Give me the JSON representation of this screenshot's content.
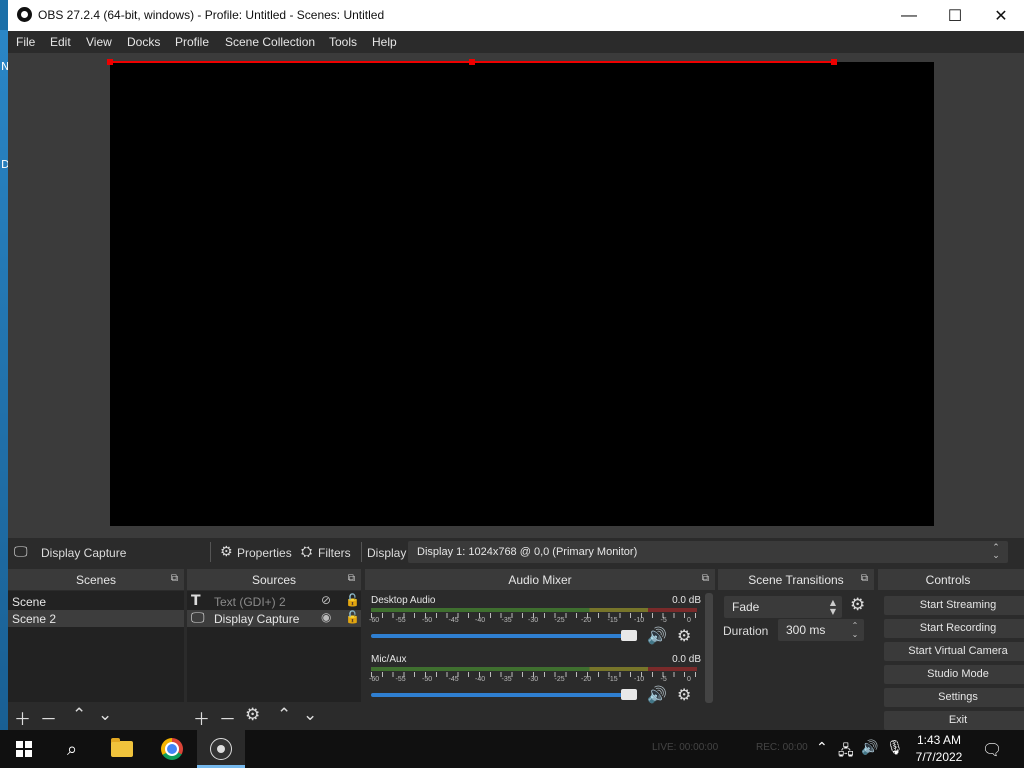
{
  "window": {
    "title": "OBS 27.2.4 (64-bit, windows) - Profile: Untitled - Scenes: Untitled",
    "minimize": "—",
    "maximize": "☐",
    "close": "✕"
  },
  "desktop": {
    "glyph_1": "N",
    "glyph_2": "D"
  },
  "menu": [
    "File",
    "Edit",
    "View",
    "Docks",
    "Profile",
    "Scene Collection",
    "Tools",
    "Help"
  ],
  "source_toolbar": {
    "selected_source": "Display Capture",
    "properties": "Properties",
    "filters": "Filters",
    "display_label": "Display",
    "display_value": "Display 1: 1024x768 @ 0,0 (Primary Monitor)"
  },
  "scenes": {
    "title": "Scenes",
    "items": [
      "Scene",
      "Scene 2"
    ]
  },
  "sources": {
    "title": "Sources",
    "items": [
      "Text (GDI+) 2",
      "Display Capture"
    ]
  },
  "mixer": {
    "title": "Audio Mixer",
    "channels": [
      {
        "name": "Desktop Audio",
        "db": "0.0 dB",
        "volume": 1.0
      },
      {
        "name": "Mic/Aux",
        "db": "0.0 dB",
        "volume": 1.0
      }
    ],
    "scale": [
      "-60",
      "-55",
      "-50",
      "-45",
      "-40",
      "-35",
      "-30",
      "-25",
      "-20",
      "-15",
      "-10",
      "-5",
      "0"
    ]
  },
  "transitions": {
    "title": "Scene Transitions",
    "transition": "Fade",
    "duration_label": "Duration",
    "duration_value": "300 ms"
  },
  "controls": {
    "title": "Controls",
    "buttons": [
      "Start Streaming",
      "Start Recording",
      "Start Virtual Camera",
      "Studio Mode",
      "Settings",
      "Exit"
    ]
  },
  "status": {
    "live": "LIVE: 00:00:00",
    "rec": "REC: 00:00"
  },
  "taskbar": {
    "time": "1:43 AM",
    "date": "7/7/2022"
  }
}
